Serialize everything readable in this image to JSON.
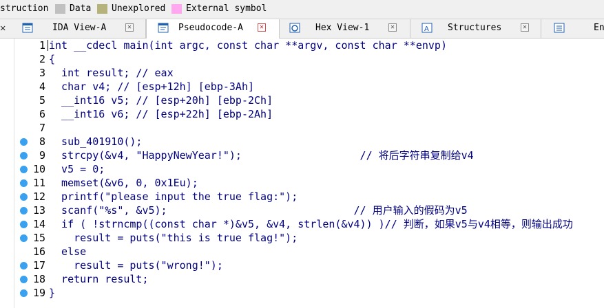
{
  "legend": {
    "items": [
      {
        "label": "struction",
        "color": ""
      },
      {
        "label": "Data",
        "color": "#c0c0c0"
      },
      {
        "label": "Unexplored",
        "color": "#b5b27b"
      },
      {
        "label": "External symbol",
        "color": "#ffa8f0"
      }
    ]
  },
  "tabs": [
    {
      "label": "IDA View-A",
      "icon": "ida-view-icon",
      "active": false
    },
    {
      "label": "Pseudocode-A",
      "icon": "pseudocode-icon",
      "active": true
    },
    {
      "label": "Hex View-1",
      "icon": "hex-view-icon",
      "active": false
    },
    {
      "label": "Structures",
      "icon": "structures-icon",
      "active": false
    },
    {
      "label": "En",
      "icon": "enums-icon",
      "active": false
    }
  ],
  "editor": {
    "lines": [
      {
        "n": "1",
        "dot": false,
        "text": "int __cdecl main(int argc, const char **argv, const char **envp)"
      },
      {
        "n": "2",
        "dot": false,
        "text": "{"
      },
      {
        "n": "3",
        "dot": false,
        "text": "  int result; // eax"
      },
      {
        "n": "4",
        "dot": false,
        "text": "  char v4; // [esp+12h] [ebp-3Ah]"
      },
      {
        "n": "5",
        "dot": false,
        "text": "  __int16 v5; // [esp+20h] [ebp-2Ch]"
      },
      {
        "n": "6",
        "dot": false,
        "text": "  __int16 v6; // [esp+22h] [ebp-2Ah]"
      },
      {
        "n": "7",
        "dot": false,
        "text": ""
      },
      {
        "n": "8",
        "dot": true,
        "text": "  sub_401910();"
      },
      {
        "n": "9",
        "dot": true,
        "text": "  strcpy(&v4, \"HappyNewYear!\");                   // 将后字符串复制给v4"
      },
      {
        "n": "10",
        "dot": true,
        "text": "  v5 = 0;"
      },
      {
        "n": "11",
        "dot": true,
        "text": "  memset(&v6, 0, 0x1Eu);"
      },
      {
        "n": "12",
        "dot": true,
        "text": "  printf(\"please input the true flag:\");"
      },
      {
        "n": "13",
        "dot": true,
        "text": "  scanf(\"%s\", &v5);                              // 用户输入的假码为v5"
      },
      {
        "n": "14",
        "dot": true,
        "text": "  if ( !strncmp((const char *)&v5, &v4, strlen(&v4)) )// 判断，如果v5与v4相等，则输出成功"
      },
      {
        "n": "15",
        "dot": true,
        "text": "    result = puts(\"this is true flag!\");"
      },
      {
        "n": "16",
        "dot": false,
        "text": "  else"
      },
      {
        "n": "17",
        "dot": true,
        "text": "    result = puts(\"wrong!\");"
      },
      {
        "n": "18",
        "dot": true,
        "text": "  return result;"
      },
      {
        "n": "19",
        "dot": true,
        "text": "}"
      }
    ]
  },
  "colors": {
    "breakpoint_dot": "#3aa0f0",
    "code": "#000080",
    "variable": "#8080a0"
  }
}
